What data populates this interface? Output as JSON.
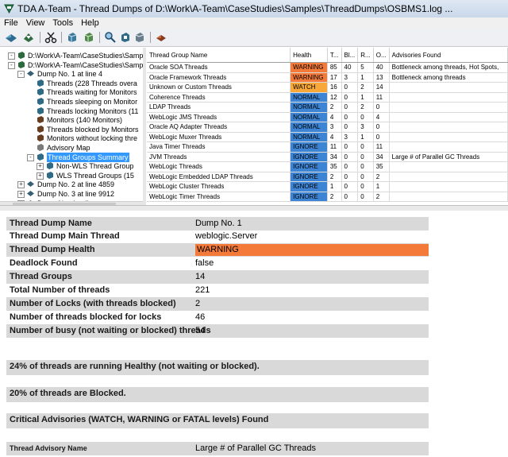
{
  "window": {
    "title": "TDA A-Team - Thread Dumps of D:\\Work\\A-Team\\CaseStudies\\Samples\\ThreadDumps\\OSBMS1.log ..."
  },
  "menu": [
    "File",
    "View",
    "Tools",
    "Help"
  ],
  "toolbar": {
    "buttons": [
      "open-icon",
      "open-logfile-icon",
      "cut-icon",
      "dump-icon",
      "dump-icon",
      "zoom-icon",
      "monitor-icon",
      "dump-icon",
      "tools-icon"
    ]
  },
  "tree": {
    "nodes": [
      {
        "label": "D:\\Work\\A-Team\\CaseStudies\\Samp",
        "exp": "-",
        "depth": 0,
        "icon": "root"
      },
      {
        "label": "D:\\Work\\A-Team\\CaseStudies\\Samp",
        "exp": "-",
        "depth": 0,
        "icon": "root"
      },
      {
        "label": "Dump No. 1 at line 4",
        "exp": "-",
        "depth": 1,
        "icon": "dump"
      },
      {
        "label": "Threads (228 Threads overa",
        "exp": "",
        "depth": 2,
        "icon": "threads"
      },
      {
        "label": "Threads waiting for Monitors",
        "exp": "",
        "depth": 2,
        "icon": "threads"
      },
      {
        "label": "Threads sleeping on Monitor",
        "exp": "",
        "depth": 2,
        "icon": "threads"
      },
      {
        "label": "Threads locking Monitors (11",
        "exp": "",
        "depth": 2,
        "icon": "threads"
      },
      {
        "label": "Monitors (140 Monitors)",
        "exp": "",
        "depth": 2,
        "icon": "monitor"
      },
      {
        "label": "Threads blocked by Monitors",
        "exp": "",
        "depth": 2,
        "icon": "monitor"
      },
      {
        "label": "Monitors without locking thre",
        "exp": "",
        "depth": 2,
        "icon": "monitor"
      },
      {
        "label": "Advisory Map",
        "exp": "",
        "depth": 2,
        "icon": "doc"
      },
      {
        "label": "Thread Groups Summary",
        "exp": "-",
        "depth": 2,
        "icon": "group",
        "selected": true
      },
      {
        "label": "Non-WLS Thread Group",
        "exp": "+",
        "depth": 3,
        "icon": "group"
      },
      {
        "label": "WLS Thread Groups (15",
        "exp": "+",
        "depth": 3,
        "icon": "group"
      },
      {
        "label": "Dump No. 2 at line 4859",
        "exp": "+",
        "depth": 1,
        "icon": "dump"
      },
      {
        "label": "Dump No. 3 at line 9912",
        "exp": "+",
        "depth": 1,
        "icon": "dump"
      },
      {
        "label": "Dump No. 4 at line",
        "exp": "+",
        "depth": 1,
        "icon": "dump"
      }
    ]
  },
  "table": {
    "columns": [
      "Thread Group Name",
      "Health",
      "T...",
      "Bl...",
      "R...",
      "O...",
      "Advisories Found"
    ],
    "rows": [
      {
        "name": "Oracle SOA Threads",
        "health": "WARNING",
        "t": "85",
        "bl": "40",
        "r": "5",
        "o": "40",
        "adv": "Bottleneck among threads, Hot Spots,"
      },
      {
        "name": "Oracle Framework Threads",
        "health": "WARNING",
        "t": "17",
        "bl": "3",
        "r": "1",
        "o": "13",
        "adv": "Bottleneck among threads"
      },
      {
        "name": "Unknown or Custom Threads",
        "health": "WATCH",
        "t": "16",
        "bl": "0",
        "r": "2",
        "o": "14",
        "adv": ""
      },
      {
        "name": "Coherence Threads",
        "health": "NORMAL",
        "t": "12",
        "bl": "0",
        "r": "1",
        "o": "11",
        "adv": ""
      },
      {
        "name": "LDAP Threads",
        "health": "NORMAL",
        "t": "2",
        "bl": "0",
        "r": "2",
        "o": "0",
        "adv": ""
      },
      {
        "name": "WebLogic JMS Threads",
        "health": "NORMAL",
        "t": "4",
        "bl": "0",
        "r": "0",
        "o": "4",
        "adv": ""
      },
      {
        "name": "Oracle AQ Adapter Threads",
        "health": "NORMAL",
        "t": "3",
        "bl": "0",
        "r": "3",
        "o": "0",
        "adv": ""
      },
      {
        "name": "WebLogic Muxer Threads",
        "health": "NORMAL",
        "t": "4",
        "bl": "3",
        "r": "1",
        "o": "0",
        "adv": ""
      },
      {
        "name": "Java Timer Threads",
        "health": "IGNORE",
        "t": "11",
        "bl": "0",
        "r": "0",
        "o": "11",
        "adv": ""
      },
      {
        "name": "JVM Threads",
        "health": "IGNORE",
        "t": "34",
        "bl": "0",
        "r": "0",
        "o": "34",
        "adv": "Large # of Parallel GC Threads"
      },
      {
        "name": "WebLogic Threads",
        "health": "IGNORE",
        "t": "35",
        "bl": "0",
        "r": "0",
        "o": "35",
        "adv": ""
      },
      {
        "name": "WebLogic Embedded LDAP Threads",
        "health": "IGNORE",
        "t": "2",
        "bl": "0",
        "r": "0",
        "o": "2",
        "adv": ""
      },
      {
        "name": "WebLogic Cluster Threads",
        "health": "IGNORE",
        "t": "1",
        "bl": "0",
        "r": "0",
        "o": "1",
        "adv": ""
      },
      {
        "name": "WebLogic Timer Threads",
        "health": "IGNORE",
        "t": "2",
        "bl": "0",
        "r": "0",
        "o": "2",
        "adv": ""
      }
    ]
  },
  "details": {
    "rows": [
      {
        "key": "Thread Dump Name",
        "value": "Dump No. 1"
      },
      {
        "key": "Thread Dump Main Thread",
        "value": "weblogic.Server"
      },
      {
        "key": "Thread Dump Health",
        "value": "WARNING"
      },
      {
        "key": "Deadlock Found",
        "value": "false"
      },
      {
        "key": "Thread Groups",
        "value": "14"
      },
      {
        "key": "Total Number of threads",
        "value": "221"
      },
      {
        "key": "Number of Locks (with threads blocked)",
        "value": "2"
      },
      {
        "key": "Number of threads blocked for locks",
        "value": "46"
      },
      {
        "key": "Number of busy (not waiting or blocked) threads",
        "value": "54"
      }
    ],
    "healthy_statement": "24% of threads are running Healthy (not waiting or blocked).",
    "blocked_statement": "20% of threads are Blocked.",
    "advisories_heading": "Critical Advisories (WATCH, WARNING or FATAL levels) Found",
    "advisory_key": "Thread Advisory Name",
    "advisory_value": "Large # of Parallel GC Threads"
  },
  "colors": {
    "warning": "#f47a3a",
    "watch": "#f7a838",
    "normal": "#3d85d4",
    "ignore": "#3d85d4",
    "selection": "#3399ff"
  }
}
